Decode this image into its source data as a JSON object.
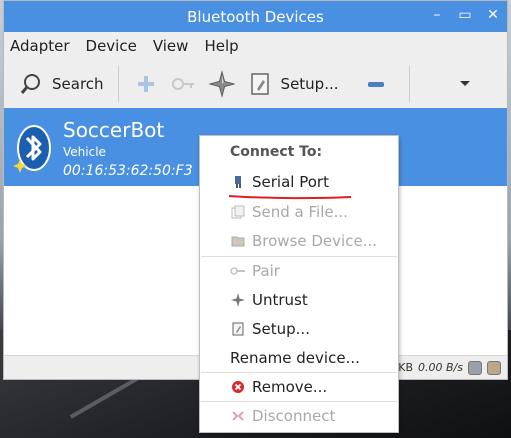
{
  "window": {
    "title": "Bluetooth Devices",
    "controls": [
      "–",
      "▭",
      "✕"
    ]
  },
  "menu": [
    "Adapter",
    "Device",
    "View",
    "Help"
  ],
  "toolbar": {
    "search_label": "Search",
    "setup_label": "Setup..."
  },
  "device": {
    "name": "SoccerBot",
    "type": "Vehicle",
    "address": "00:16:53:62:50:F3"
  },
  "status": {
    "rx_unit": "KB",
    "rate": "0.00 B/s"
  },
  "context_menu": {
    "header": "Connect To:",
    "serial_port": "Serial Port",
    "send_file": "Send a File...",
    "browse_device": "Browse Device...",
    "pair": "Pair",
    "untrust": "Untrust",
    "setup": "Setup...",
    "rename": "Rename device...",
    "remove": "Remove...",
    "disconnect": "Disconnect"
  },
  "colors": {
    "accent": "#4a90e2",
    "annotation": "#e02020"
  }
}
